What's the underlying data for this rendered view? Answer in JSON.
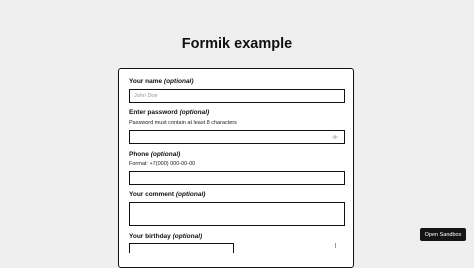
{
  "page": {
    "title": "Formik example"
  },
  "form": {
    "name": {
      "label": "Your name",
      "optional": "(optional)",
      "placeholder": "John Doe"
    },
    "password": {
      "label": "Enter password",
      "optional": "(optional)",
      "hint": "Password must contain at least 8 characters",
      "icon": "eye-icon"
    },
    "phone": {
      "label": "Phone",
      "optional": "(optional)",
      "hint": "Format: +7(000) 000-00-00"
    },
    "comment": {
      "label": "Your comment",
      "optional": "(optional)"
    },
    "birthday": {
      "label": "Your birthday",
      "optional": "(optional)"
    }
  },
  "sandbox": {
    "label": "Open Sandbox"
  }
}
